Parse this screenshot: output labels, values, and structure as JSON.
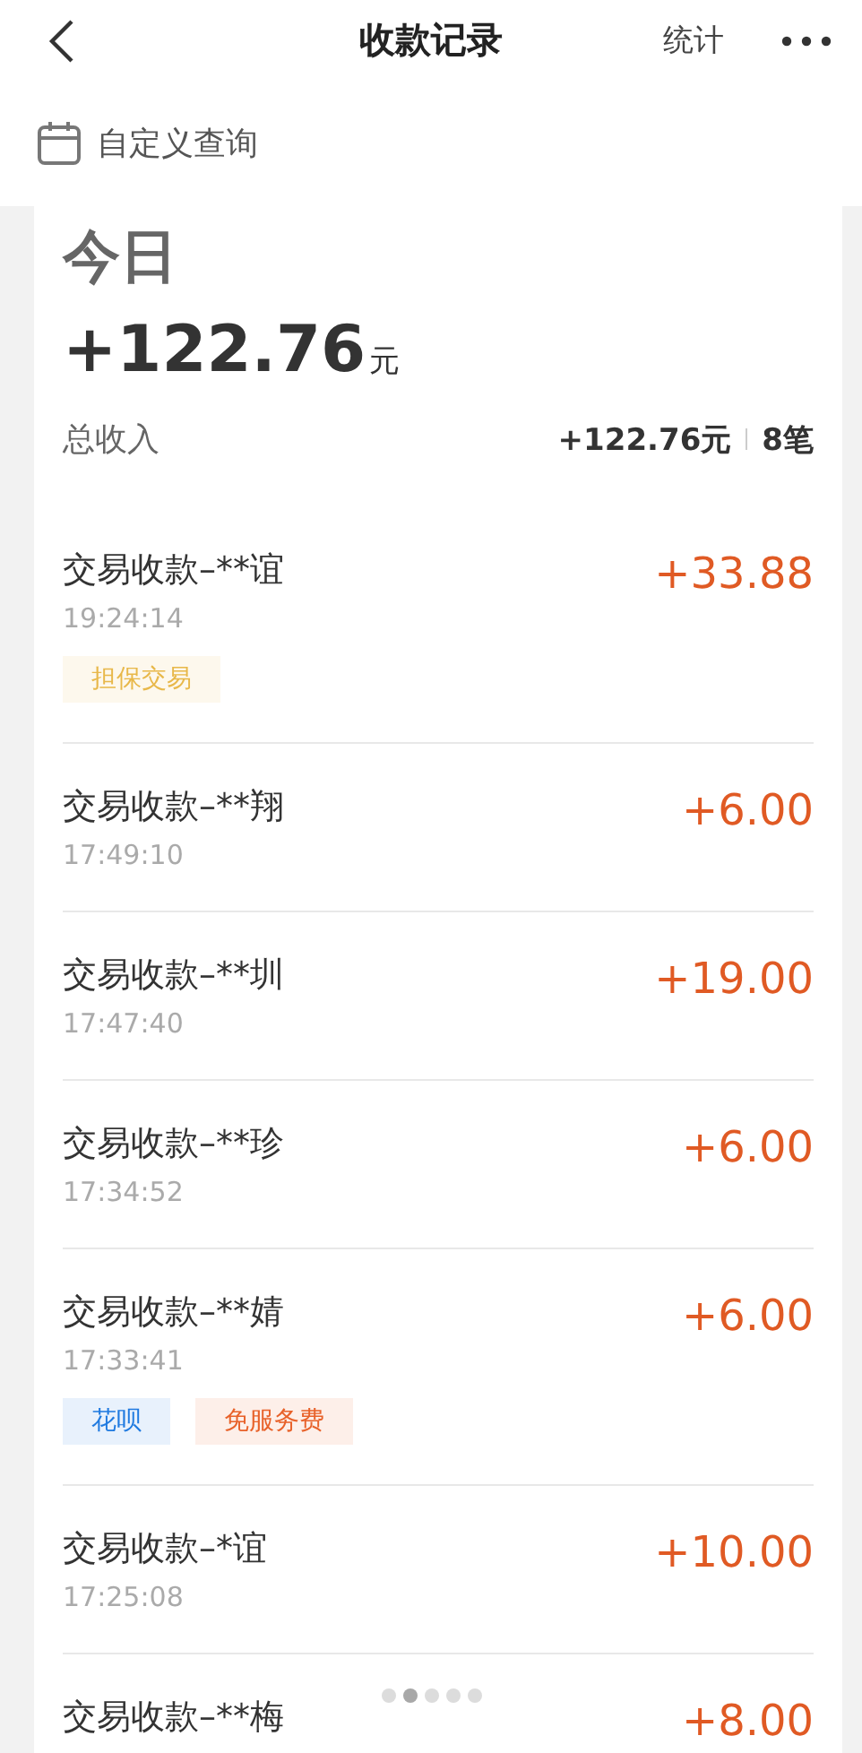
{
  "nav": {
    "title": "收款记录",
    "action": "统计"
  },
  "filter": {
    "label": "自定义查询"
  },
  "summary": {
    "period": "今日",
    "amount": "+122.76",
    "unit": "元",
    "total_label": "总收入",
    "total_amount": "+122.76元",
    "count": "8笔"
  },
  "records": [
    {
      "title": "交易收款–**谊",
      "time": "19:24:14",
      "amount": "+33.88",
      "tags": [
        {
          "label": "担保交易",
          "color": "#e8b84a"
        }
      ]
    },
    {
      "title": "交易收款–**翔",
      "time": "17:49:10",
      "amount": "+6.00"
    },
    {
      "title": "交易收款–**圳",
      "time": "17:47:40",
      "amount": "+19.00"
    },
    {
      "title": "交易收款–**珍",
      "time": "17:34:52",
      "amount": "+6.00"
    },
    {
      "title": "交易收款–**婧",
      "time": "17:33:41",
      "amount": "+6.00",
      "tags": [
        {
          "label": "花呗",
          "color": "#1f7ae0"
        },
        {
          "label": "免服务费",
          "color": "#e8622a"
        }
      ]
    },
    {
      "title": "交易收款–*谊",
      "time": "17:25:08",
      "amount": "+10.00"
    },
    {
      "title": "交易收款–**梅",
      "amount": "+8.00"
    }
  ],
  "pager": [
    {
      "selected": false
    },
    {
      "selected": true
    },
    {
      "selected": false
    },
    {
      "selected": false
    },
    {
      "selected": false
    }
  ]
}
